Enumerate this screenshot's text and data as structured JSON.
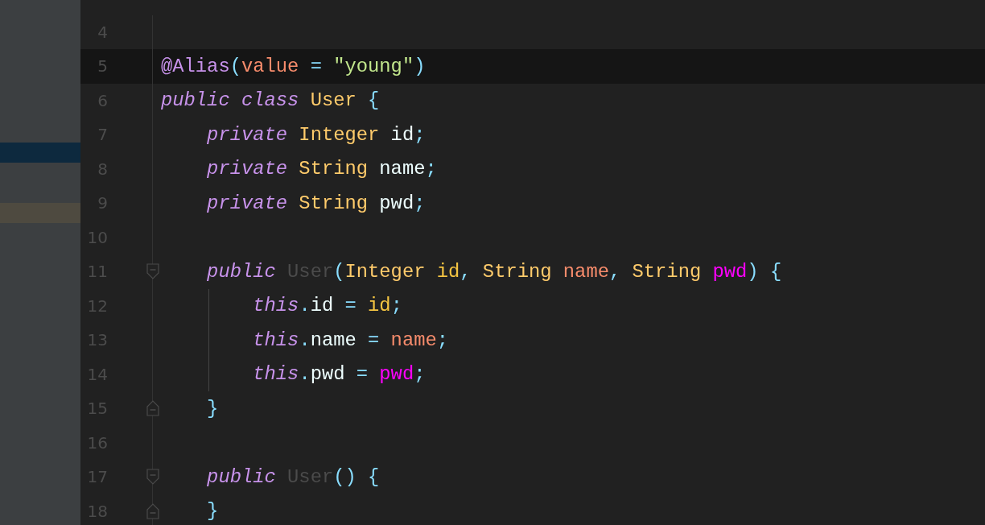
{
  "sidebar": {
    "rows": [
      {
        "kind": "plain"
      },
      {
        "kind": "plain"
      },
      {
        "kind": "plain"
      },
      {
        "kind": "plain"
      },
      {
        "kind": "plain"
      },
      {
        "kind": "plain"
      },
      {
        "kind": "plain"
      },
      {
        "kind": "selected"
      },
      {
        "kind": "plain"
      },
      {
        "kind": "plain"
      },
      {
        "kind": "highlighted"
      }
    ]
  },
  "editor": {
    "lines": [
      {
        "number": "4",
        "current": false,
        "guide": false,
        "fold_start": false,
        "fold_end": false
      },
      {
        "number": "5",
        "current": true,
        "guide": false,
        "fold_start": false,
        "fold_end": false,
        "tokens": [
          {
            "kind": "annotation",
            "text": "@Alias"
          },
          {
            "kind": "punct",
            "text": "("
          },
          {
            "kind": "attr",
            "text": "value"
          },
          {
            "kind": "punct",
            "text": " ="
          },
          {
            "kind": "string",
            "text": " \"young\""
          },
          {
            "kind": "punct",
            "text": ")"
          }
        ]
      },
      {
        "number": "6",
        "current": false,
        "guide": false,
        "fold_start": false,
        "fold_end": false,
        "tokens": [
          {
            "kind": "keyword",
            "text": "public"
          },
          {
            "kind": "keyword",
            "text": " class"
          },
          {
            "kind": "type",
            "text": " User"
          },
          {
            "kind": "punct",
            "text": " {"
          }
        ]
      },
      {
        "number": "7",
        "current": false,
        "guide": false,
        "fold_start": false,
        "fold_end": false,
        "tokens": [
          {
            "kind": "keyword",
            "text": "    private"
          },
          {
            "kind": "type",
            "text": " Integer"
          },
          {
            "kind": "plain",
            "text": " id"
          },
          {
            "kind": "punct",
            "text": ";"
          }
        ]
      },
      {
        "number": "8",
        "current": false,
        "guide": false,
        "fold_start": false,
        "fold_end": false,
        "tokens": [
          {
            "kind": "keyword",
            "text": "    private"
          },
          {
            "kind": "type",
            "text": " String"
          },
          {
            "kind": "plain",
            "text": " name"
          },
          {
            "kind": "punct",
            "text": ";"
          }
        ]
      },
      {
        "number": "9",
        "current": false,
        "guide": false,
        "fold_start": false,
        "fold_end": false,
        "tokens": [
          {
            "kind": "keyword",
            "text": "    private"
          },
          {
            "kind": "type",
            "text": " String"
          },
          {
            "kind": "plain",
            "text": " pwd"
          },
          {
            "kind": "punct",
            "text": ";"
          }
        ]
      },
      {
        "number": "10",
        "current": false,
        "guide": false,
        "fold_start": false,
        "fold_end": false
      },
      {
        "number": "11",
        "current": false,
        "guide": false,
        "fold_start": true,
        "fold_end": false,
        "tokens": [
          {
            "kind": "keyword",
            "text": "    public"
          },
          {
            "kind": "unused",
            "text": " User"
          },
          {
            "kind": "punct",
            "text": "("
          },
          {
            "kind": "type",
            "text": "Integer"
          },
          {
            "kind": "var1",
            "text": " id"
          },
          {
            "kind": "punct",
            "text": ","
          },
          {
            "kind": "type",
            "text": " String"
          },
          {
            "kind": "var2",
            "text": " name"
          },
          {
            "kind": "punct",
            "text": ","
          },
          {
            "kind": "type",
            "text": " String"
          },
          {
            "kind": "var3",
            "text": " pwd"
          },
          {
            "kind": "punct",
            "text": ") {"
          }
        ]
      },
      {
        "number": "12",
        "current": false,
        "guide": true,
        "fold_start": false,
        "fold_end": false,
        "tokens": [
          {
            "kind": "keyword",
            "text": "        this"
          },
          {
            "kind": "punct",
            "text": "."
          },
          {
            "kind": "plain",
            "text": "id"
          },
          {
            "kind": "punct",
            "text": " ="
          },
          {
            "kind": "var1",
            "text": " id"
          },
          {
            "kind": "punct",
            "text": ";"
          }
        ]
      },
      {
        "number": "13",
        "current": false,
        "guide": true,
        "fold_start": false,
        "fold_end": false,
        "tokens": [
          {
            "kind": "keyword",
            "text": "        this"
          },
          {
            "kind": "punct",
            "text": "."
          },
          {
            "kind": "plain",
            "text": "name"
          },
          {
            "kind": "punct",
            "text": " ="
          },
          {
            "kind": "var2",
            "text": " name"
          },
          {
            "kind": "punct",
            "text": ";"
          }
        ]
      },
      {
        "number": "14",
        "current": false,
        "guide": true,
        "fold_start": false,
        "fold_end": false,
        "tokens": [
          {
            "kind": "keyword",
            "text": "        this"
          },
          {
            "kind": "punct",
            "text": "."
          },
          {
            "kind": "plain",
            "text": "pwd"
          },
          {
            "kind": "punct",
            "text": " ="
          },
          {
            "kind": "var3",
            "text": " pwd"
          },
          {
            "kind": "punct",
            "text": ";"
          }
        ]
      },
      {
        "number": "15",
        "current": false,
        "guide": false,
        "fold_start": false,
        "fold_end": true,
        "tokens": [
          {
            "kind": "punct",
            "text": "    }"
          }
        ]
      },
      {
        "number": "16",
        "current": false,
        "guide": false,
        "fold_start": false,
        "fold_end": false
      },
      {
        "number": "17",
        "current": false,
        "guide": false,
        "fold_start": true,
        "fold_end": false,
        "tokens": [
          {
            "kind": "keyword",
            "text": "    public"
          },
          {
            "kind": "unused",
            "text": " User"
          },
          {
            "kind": "punct",
            "text": "() {"
          }
        ]
      },
      {
        "number": "18",
        "current": false,
        "guide": false,
        "fold_start": false,
        "fold_end": true,
        "tokens": [
          {
            "kind": "punct",
            "text": "    }"
          }
        ]
      }
    ]
  }
}
